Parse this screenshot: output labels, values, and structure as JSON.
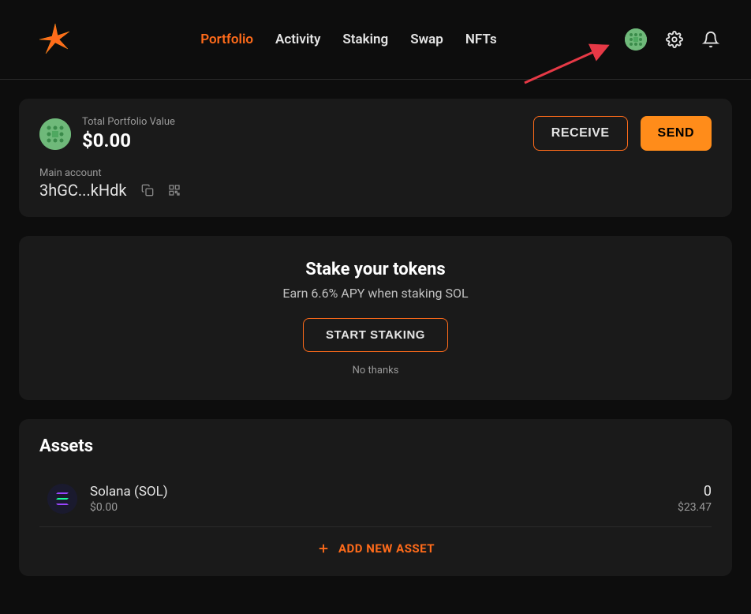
{
  "nav": {
    "items": [
      {
        "label": "Portfolio",
        "active": true
      },
      {
        "label": "Activity",
        "active": false
      },
      {
        "label": "Staking",
        "active": false
      },
      {
        "label": "Swap",
        "active": false
      },
      {
        "label": "NFTs",
        "active": false
      }
    ]
  },
  "portfolio": {
    "label": "Total Portfolio Value",
    "value": "$0.00",
    "receive_label": "RECEIVE",
    "send_label": "SEND"
  },
  "account": {
    "label": "Main account",
    "address_short": "3hGC...kHdk"
  },
  "promo": {
    "title": "Stake your tokens",
    "subtitle": "Earn 6.6% APY when staking SOL",
    "cta": "START STAKING",
    "dismiss": "No thanks"
  },
  "assets": {
    "title": "Assets",
    "items": [
      {
        "name": "Solana (SOL)",
        "fiat_value": "$0.00",
        "amount": "0",
        "price": "$23.47"
      }
    ],
    "add_label": "ADD NEW ASSET"
  },
  "colors": {
    "accent": "#ff6b1a",
    "accent_fill": "#ff8c1a",
    "account_avatar": "#6fb97a"
  }
}
